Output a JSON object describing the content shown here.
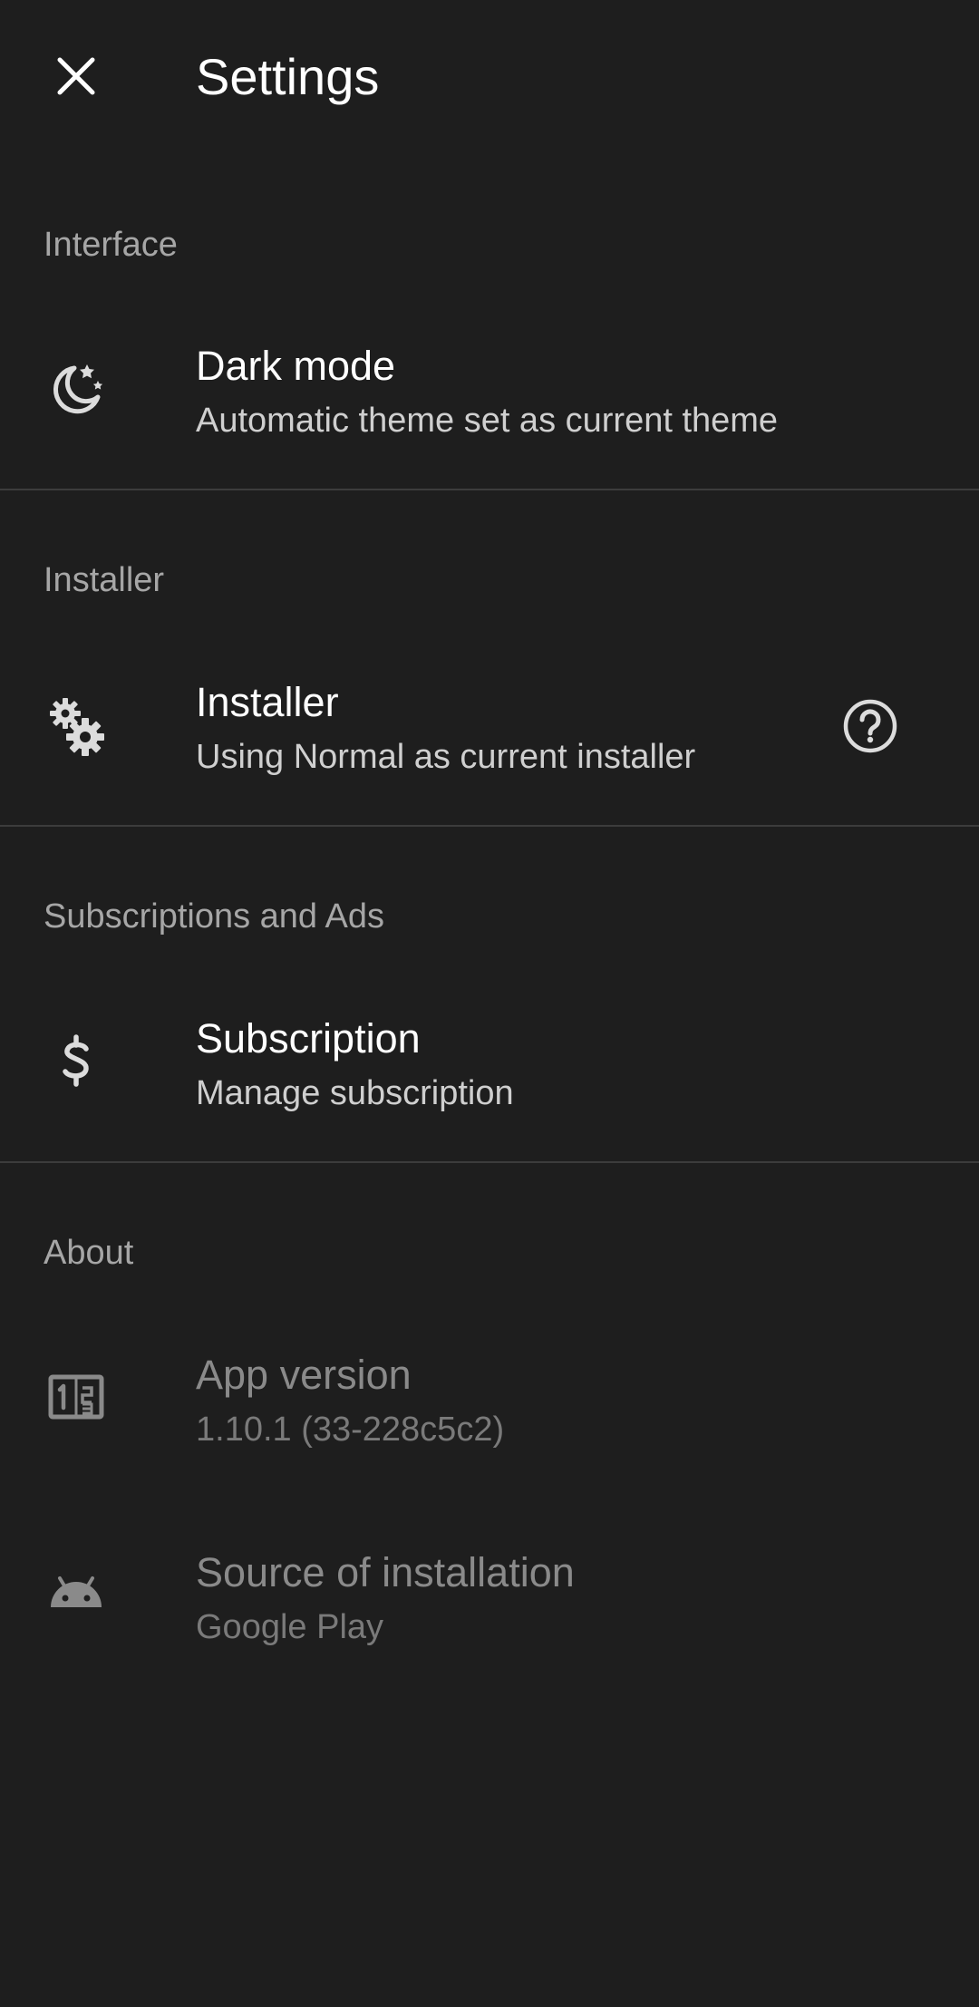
{
  "appbar": {
    "title": "Settings",
    "close_icon": "close-icon"
  },
  "sections": {
    "interface": {
      "header": "Interface",
      "dark_mode": {
        "icon": "moon-stars-icon",
        "title": "Dark mode",
        "subtitle": "Automatic theme set as current theme"
      }
    },
    "installer": {
      "header": "Installer",
      "installer": {
        "icon": "gears-icon",
        "title": "Installer",
        "subtitle": "Using Normal as current installer",
        "help_icon": "help-circle-icon"
      }
    },
    "subscriptions": {
      "header": "Subscriptions and Ads",
      "subscription": {
        "icon": "dollar-icon",
        "title": "Subscription",
        "subtitle": "Manage subscription"
      }
    },
    "about": {
      "header": "About",
      "app_version": {
        "icon": "version-numbers-icon",
        "title": "App version",
        "subtitle": "1.10.1 (33-228c5c2)"
      },
      "source": {
        "icon": "android-icon",
        "title": "Source of installation",
        "subtitle": "Google Play"
      }
    }
  },
  "colors": {
    "background": "#1e1e1e",
    "text_primary": "#ffffff",
    "text_secondary": "#cfcfcf",
    "section_header": "#a6a6a6",
    "disabled_text": "#8a8a8a",
    "divider": "#3c3c3c"
  }
}
